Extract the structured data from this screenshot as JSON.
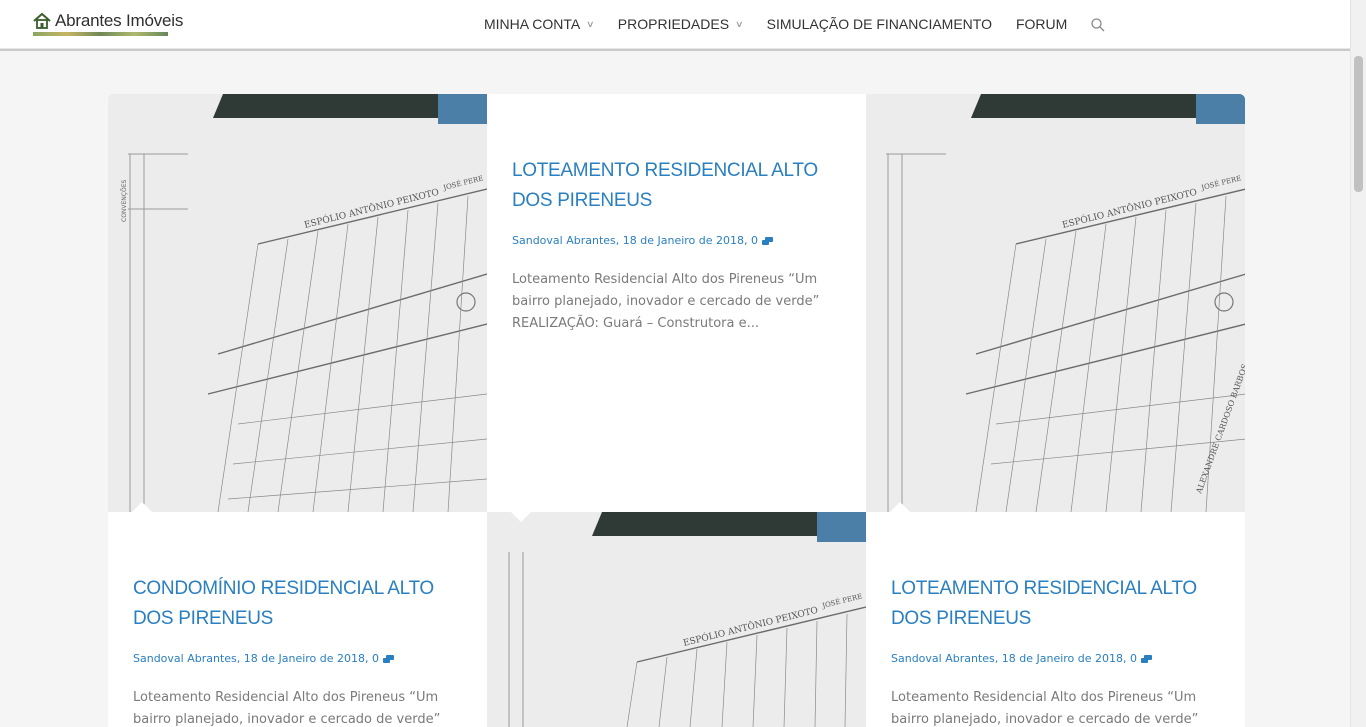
{
  "brand": {
    "name": "Abrantes Imóveis"
  },
  "nav": {
    "items": [
      {
        "label": "MINHA CONTA",
        "has_dropdown": true
      },
      {
        "label": "PROPRIEDADES",
        "has_dropdown": true
      },
      {
        "label": "SIMULAÇÃO DE FINANCIAMENTO",
        "has_dropdown": false
      },
      {
        "label": "FORUM",
        "has_dropdown": false
      }
    ],
    "search_icon": "search-icon"
  },
  "posts": [
    {
      "title": "LOTEAMENTO RESIDENCIAL ALTO DOS PIRENEUS",
      "meta": "Sandoval Abrantes, 18 de Janeiro de 2018, 0",
      "excerpt": "Loteamento Residencial Alto dos Pireneus “Um bairro planejado, inovador e cercado de verde”   REALIZAÇÃO: Guará – Construtora e..."
    },
    {
      "title": "CONDOMÍNIO RESIDENCIAL ALTO DOS PIRENEUS",
      "meta": "Sandoval Abrantes, 18 de Janeiro de 2018, 0",
      "excerpt": "Loteamento Residencial Alto dos Pireneus “Um bairro planejado, inovador e cercado de verde”   REALIZAÇÃO:"
    },
    {
      "title": "LOTEAMENTO RESIDENCIAL ALTO DOS PIRENEUS",
      "meta": "Sandoval Abrantes, 18 de Janeiro de 2018, 0",
      "excerpt": "Loteamento Residencial Alto dos Pireneus “Um bairro planejado, inovador e cercado de verde”   REALIZAÇÃO:"
    }
  ],
  "plan_image": {
    "labels": [
      "ESPÓLIO ANTÔNIO PEIXOTO",
      "JOSÉ PERE",
      "ALEXANDRE CARDOSO BARBOS",
      "CONVENÇÕES"
    ]
  },
  "colors": {
    "link": "#2a7fc0",
    "text": "#7a7a7a",
    "nav_text": "#333333"
  }
}
